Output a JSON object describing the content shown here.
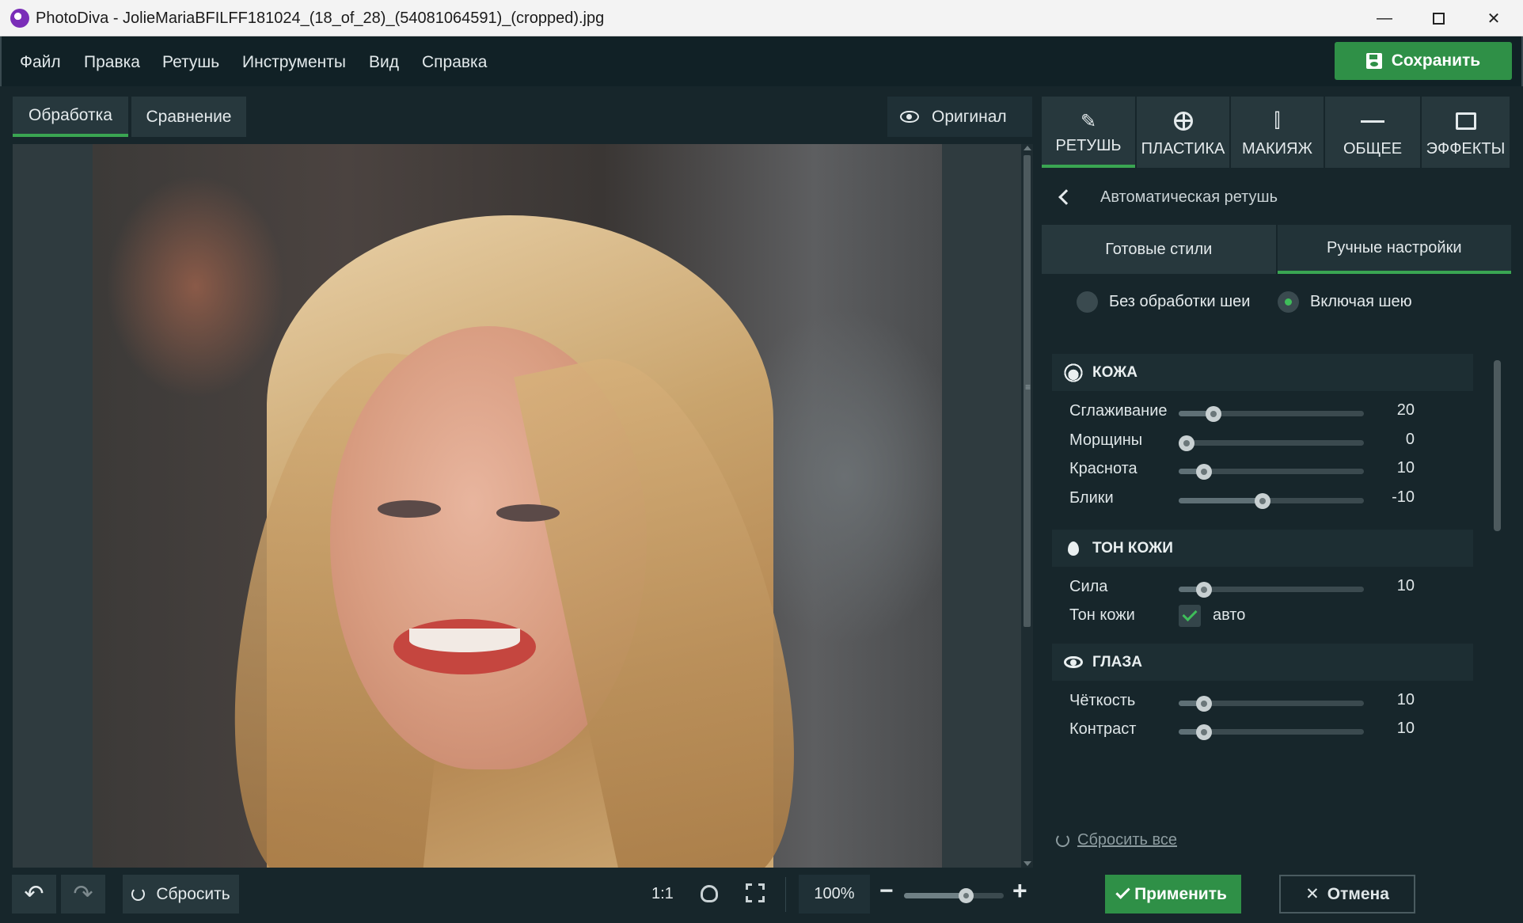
{
  "window": {
    "title": "PhotoDiva - JolieMariaBFILFF181024_(18_of_28)_(54081064591)_(cropped).jpg",
    "minimize": "—",
    "close": "✕"
  },
  "menu": {
    "items": [
      "Файл",
      "Правка",
      "Ретушь",
      "Инструменты",
      "Вид",
      "Справка"
    ],
    "save_label": "Сохранить"
  },
  "view_tabs": {
    "processing": "Обработка",
    "compare": "Сравнение",
    "original": "Оригинал"
  },
  "bottom_toolbar": {
    "undo": "↶",
    "redo": "↷",
    "reset": "Сбросить",
    "ratio": "1:1",
    "zoom": "100%",
    "zoom_minus": "−",
    "zoom_plus": "+",
    "zoom_level": 0.62
  },
  "category_tabs": [
    {
      "label": "РЕТУШЬ",
      "icon": "retouch-brush-icon",
      "active": true
    },
    {
      "label": "ПЛАСТИКА",
      "icon": "plastic-target-icon",
      "active": false
    },
    {
      "label": "МАКИЯЖ",
      "icon": "makeup-icon",
      "active": false
    },
    {
      "label": "ОБЩЕЕ",
      "icon": "sliders-icon",
      "active": false
    },
    {
      "label": "ЭФФЕКТЫ",
      "icon": "effects-frame-icon",
      "active": false
    }
  ],
  "panel": {
    "header": "Автоматическая ретушь",
    "sub_tabs": [
      "Готовые стили",
      "Ручные настройки"
    ],
    "radio_no_neck": "Без обработки шеи",
    "radio_with_neck": "Включая шею",
    "sections": {
      "skin": {
        "title": "КОЖА",
        "rows": [
          {
            "label": "Сглаживание",
            "value": "20"
          },
          {
            "label": "Морщины",
            "value": "0"
          },
          {
            "label": "Краснота",
            "value": "10"
          },
          {
            "label": "Блики",
            "value": "-10"
          }
        ]
      },
      "skin_tone": {
        "title": "ТОН КОЖИ",
        "strength_label": "Сила",
        "strength_value": "10",
        "tone_label": "Тон кожи",
        "auto_label": "авто"
      },
      "eyes": {
        "title": "ГЛАЗА",
        "rows": [
          {
            "label": "Чёткость",
            "value": "10"
          },
          {
            "label": "Контраст",
            "value": "10"
          }
        ]
      }
    },
    "reset_all": "Сбросить все",
    "apply": "Применить",
    "cancel": "Отмена"
  },
  "colors": {
    "accent": "#2f9047",
    "background": "#17262b",
    "panel": "#27383d"
  }
}
